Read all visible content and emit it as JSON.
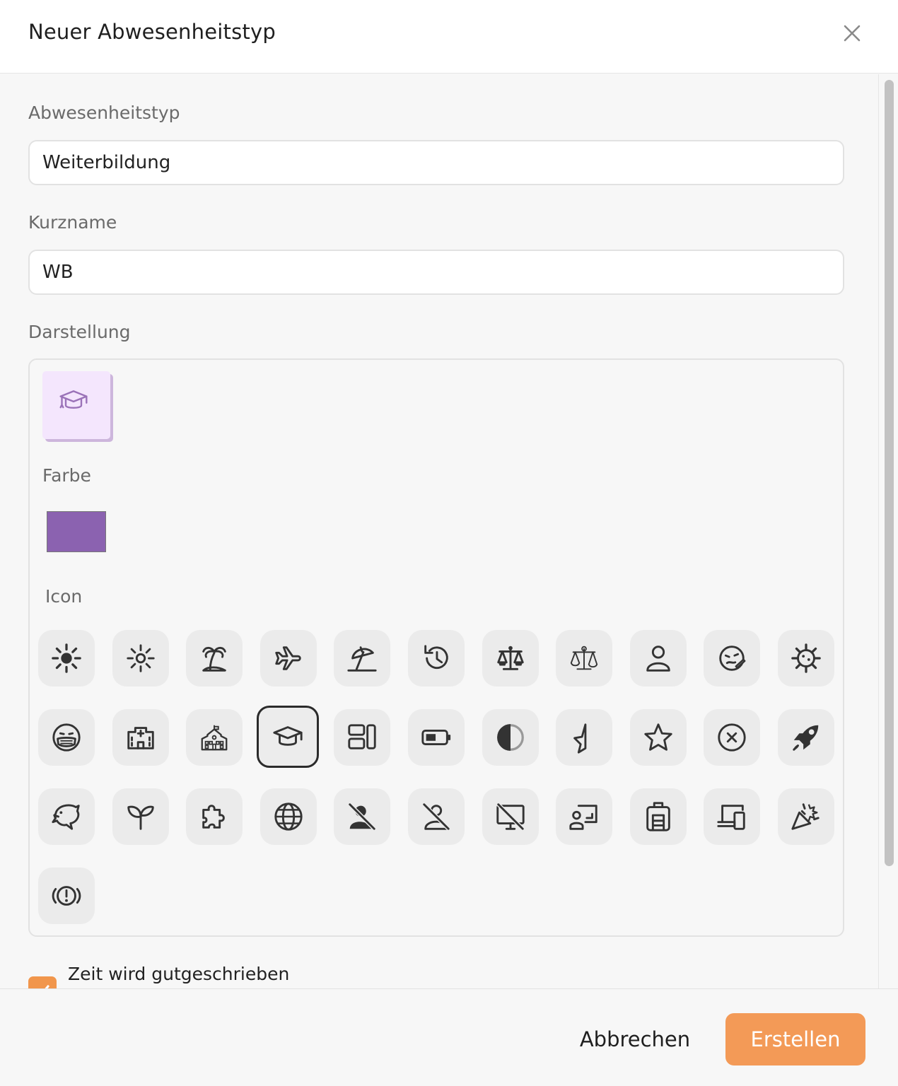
{
  "dialog": {
    "title": "Neuer Abwesenheitstyp"
  },
  "form": {
    "absence_type": {
      "label": "Abwesenheitstyp",
      "value": "Weiterbildung"
    },
    "short_name": {
      "label": "Kurzname",
      "value": "WB"
    },
    "appearance": {
      "label": "Darstellung",
      "preview_icon": "graduation-cap-icon",
      "color_label": "Farbe",
      "color_value": "#8b62b0",
      "icon_label": "Icon",
      "selected_icon": "graduation-cap-icon",
      "icons": [
        "sun-filled-icon",
        "sun-outline-icon",
        "palm-tree-icon",
        "airplane-icon",
        "beach-umbrella-icon",
        "history-icon",
        "scales-filled-icon",
        "scales-outline-icon",
        "person-icon",
        "sick-face-icon",
        "virus-icon",
        "face-mask-icon",
        "hospital-icon",
        "school-building-icon",
        "graduation-cap-icon",
        "dashboard-icon",
        "battery-low-icon",
        "contrast-icon",
        "star-half-icon",
        "star-icon",
        "cancel-circle-icon",
        "rocket-icon",
        "dolphin-icon",
        "sprout-icon",
        "puzzle-icon",
        "globe-icon",
        "person-off-filled-icon",
        "person-off-outline-icon",
        "desktop-off-icon",
        "presenter-board-icon",
        "luggage-icon",
        "devices-icon",
        "celebration-icon",
        "alert-circle-icon"
      ]
    },
    "credited": {
      "label": "Zeit wird gutgeschrieben",
      "checked": true
    }
  },
  "footer": {
    "cancel_label": "Abbrechen",
    "create_label": "Erstellen"
  },
  "colors": {
    "accent": "#f39a57",
    "preview_bg": "#f4e6fd",
    "preview_icon": "#9a72b8"
  }
}
